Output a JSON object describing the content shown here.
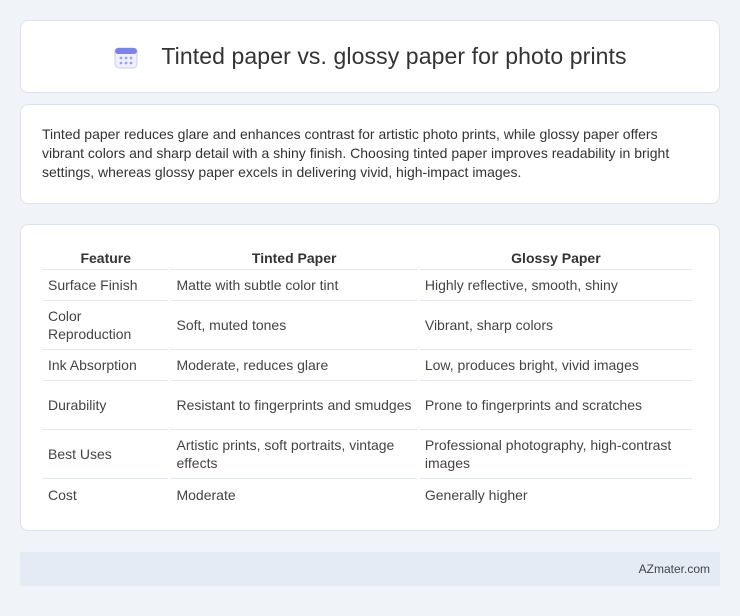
{
  "header": {
    "title": "Tinted paper vs. glossy paper for photo prints",
    "icon": "calendar-icon",
    "icon_color": "#7b83e8"
  },
  "summary": {
    "text": "Tinted paper reduces glare and enhances contrast for artistic photo prints, while glossy paper offers vibrant colors and sharp detail with a shiny finish. Choosing tinted paper improves readability in bright settings, whereas glossy paper excels in delivering vivid, high-impact images."
  },
  "table": {
    "headers": [
      "Feature",
      "Tinted Paper",
      "Glossy Paper"
    ],
    "rows": [
      [
        "Surface Finish",
        "Matte with subtle color tint",
        "Highly reflective, smooth, shiny"
      ],
      [
        "Color Reproduction",
        "Soft, muted tones",
        "Vibrant, sharp colors"
      ],
      [
        "Ink Absorption",
        "Moderate, reduces glare",
        "Low, produces bright, vivid images"
      ],
      [
        "Durability",
        "Resistant to fingerprints and smudges",
        "Prone to fingerprints and scratches"
      ],
      [
        "Best Uses",
        "Artistic prints, soft portraits, vintage effects",
        "Professional photography, high-contrast images"
      ],
      [
        "Cost",
        "Moderate",
        "Generally higher"
      ]
    ]
  },
  "footer": {
    "brand": "AZmater.com"
  }
}
